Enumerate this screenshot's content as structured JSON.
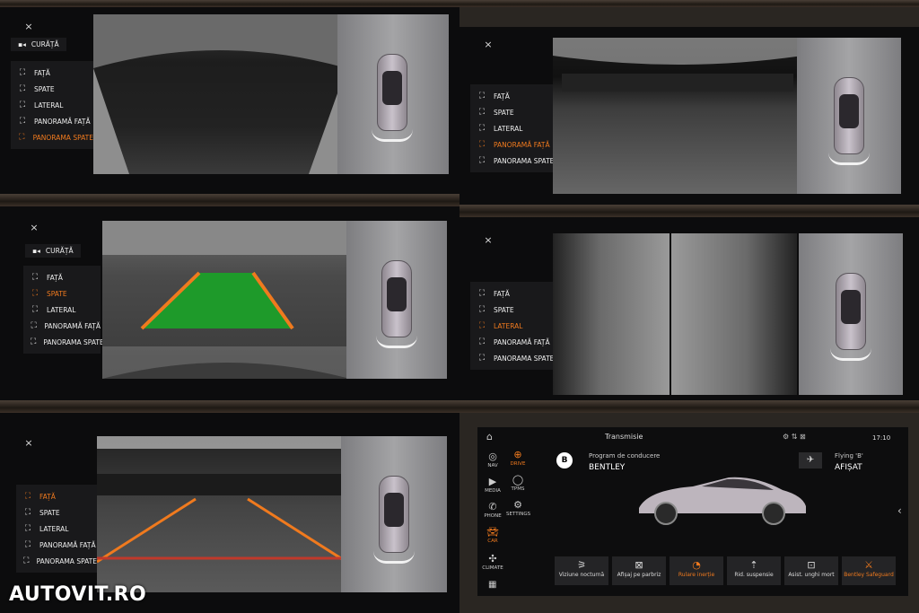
{
  "close_icon": "×",
  "clean_label": "CURĂȚĂ",
  "camera_menu": [
    "FAȚĂ",
    "SPATE",
    "LATERAL",
    "PANORAMĂ FAȚĂ",
    "PANORAMA SPATE"
  ],
  "panels": {
    "p1": {
      "active": 4
    },
    "p2": {
      "active": 3
    },
    "p3": {
      "active": 1
    },
    "p4": {
      "active": 2
    },
    "p5": {
      "active": 0
    }
  },
  "infotainment": {
    "title": "Transmisie",
    "time": "17:10",
    "left_nav": [
      {
        "label": "NAV",
        "icon": "navigation-icon"
      },
      {
        "label": "MEDIA",
        "icon": "media-icon"
      },
      {
        "label": "PHONE",
        "icon": "phone-icon"
      },
      {
        "label": "CAR",
        "icon": "car-icon"
      },
      {
        "label": "CLIMATE",
        "icon": "climate-icon"
      }
    ],
    "right_nav": [
      {
        "label": "DRIVE",
        "icon": "steering-icon"
      },
      {
        "label": "TPMS",
        "icon": "tyre-icon"
      },
      {
        "label": "SETTINGS",
        "icon": "settings-icon"
      }
    ],
    "drive_program_label": "Program de conducere",
    "drive_program_value": "BENTLEY",
    "flying_b_label": "Flying 'B'",
    "flying_b_value": "AFIȘAT",
    "tiles": [
      "Viziune nocturnă",
      "Afișaj pe parbriz",
      "Rulare inerție",
      "Rid. suspensie",
      "Asist. unghi mort",
      "Bentley Safeguard"
    ]
  },
  "watermark": "AUTOVIT.RO"
}
